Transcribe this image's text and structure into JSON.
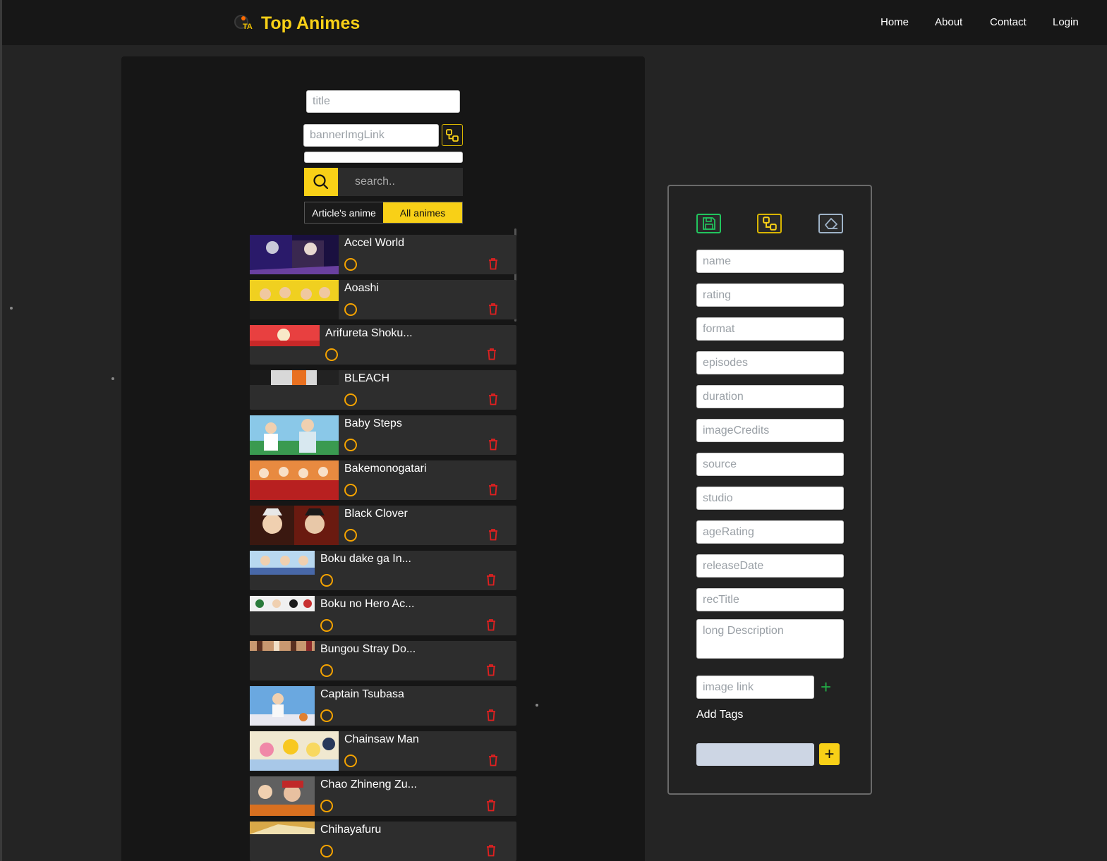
{
  "brand": {
    "title": "Top Animes",
    "logo_letters": "TA"
  },
  "nav": {
    "home": "Home",
    "about": "About",
    "contact": "Contact",
    "login": "Login"
  },
  "editor": {
    "title_placeholder": "title",
    "banner_placeholder": "bannerImgLink",
    "search_placeholder": "search..",
    "filter_article": "Article's anime",
    "filter_all": "All animes"
  },
  "animes": [
    {
      "title": "Accel World"
    },
    {
      "title": "Aoashi"
    },
    {
      "title": "Arifureta Shoku..."
    },
    {
      "title": "BLEACH"
    },
    {
      "title": "Baby Steps"
    },
    {
      "title": "Bakemonogatari"
    },
    {
      "title": "Black Clover"
    },
    {
      "title": "Boku dake ga In..."
    },
    {
      "title": "Boku no Hero Ac..."
    },
    {
      "title": "Bungou Stray Do..."
    },
    {
      "title": "Captain Tsubasa"
    },
    {
      "title": "Chainsaw Man"
    },
    {
      "title": "Chao Zhineng Zu..."
    },
    {
      "title": "Chihayafuru"
    }
  ],
  "form": {
    "name": "name",
    "rating": "rating",
    "format": "format",
    "episodes": "episodes",
    "duration": "duration",
    "imageCredits": "imageCredits",
    "source": "source",
    "studio": "studio",
    "ageRating": "ageRating",
    "releaseDate": "releaseDate",
    "recTitle": "recTitle",
    "longDescription": "long Description",
    "imageLink": "image link",
    "addTags": "Add Tags"
  },
  "icons": {
    "save": "save-icon",
    "link": "link-icon",
    "eraser": "eraser-icon",
    "search": "search-icon",
    "trash": "trash-icon",
    "status": "circle-icon",
    "plus": "plus-icon"
  },
  "colors": {
    "accent": "#f8d017",
    "status": "#f5a300",
    "delete": "#e02020",
    "save": "#22c55e",
    "eraser": "#9fb3c8"
  }
}
